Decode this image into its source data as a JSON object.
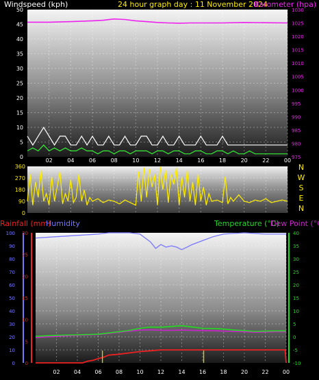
{
  "header": {
    "wind_label": "Windspeed (kph)",
    "title": "24 hour graph day : 11 November 2024",
    "baro_label": "Barometer (hpa)"
  },
  "bottom_header": {
    "rain_label": "Rainfall (mm)",
    "humidity_label": "Humidity",
    "temp_label": "Temperature (°C)",
    "dew_label": "Dew Point (°C)"
  },
  "colors": {
    "wind": "#ffffff",
    "gust": "#cccccc",
    "wind_avg": "#33ee33",
    "baro": "#ee22ee",
    "direction": "#ffee00",
    "rain": "#ee2222",
    "rain_tick": "#cccc22",
    "humidity": "#7777ff",
    "temp": "#22dd22",
    "dew": "#cc22cc"
  },
  "chart_data": [
    {
      "type": "line",
      "title": "24 hour graph day : 11 November 2024",
      "x_ticks": [
        "02",
        "04",
        "06",
        "08",
        "10",
        "12",
        "14",
        "16",
        "18",
        "20",
        "22",
        "00"
      ],
      "left_axis": {
        "label": "Windspeed (kph)",
        "ylim": [
          0,
          50
        ],
        "ticks": [
          "0",
          "5",
          "10",
          "15",
          "20",
          "25",
          "30",
          "35",
          "40",
          "45",
          "50"
        ]
      },
      "right_axis": {
        "label": "Barometer (hpa)",
        "ylim": [
          975,
          1030
        ],
        "ticks": [
          "975",
          "980",
          "985",
          "990",
          "995",
          "1000",
          "1005",
          "1010",
          "1015",
          "1020",
          "1025",
          "1030"
        ]
      },
      "series": [
        {
          "name": "Barometer (hpa)",
          "axis": "right",
          "x": [
            0,
            2,
            4,
            6,
            7,
            8,
            9,
            10,
            11,
            12,
            13,
            14,
            15,
            16,
            18,
            20,
            22,
            24
          ],
          "values": [
            1025.3,
            1025.3,
            1025.5,
            1025.8,
            1026.0,
            1026.5,
            1026.3,
            1025.8,
            1025.5,
            1025.2,
            1025.0,
            1024.9,
            1025.0,
            1025.0,
            1025.0,
            1025.2,
            1025.1,
            1025.0
          ]
        },
        {
          "axis": "left",
          "x": [
            0,
            0.5,
            1,
            1.5,
            2,
            2.5,
            3,
            3.5,
            4,
            4.5,
            5,
            5.5,
            6,
            6.5,
            7,
            7.5,
            8,
            8.5,
            9,
            9.5,
            10,
            10.5,
            11,
            11.5,
            12,
            12.5,
            13,
            13.5,
            14,
            14.5,
            15,
            15.5,
            16,
            16.5,
            17,
            17.5,
            18,
            18.5,
            19,
            19.5,
            20,
            20.5,
            21,
            21.5,
            22,
            22.5,
            23,
            23.5,
            24
          ],
          "values": [
            7,
            4,
            7,
            10,
            7,
            4,
            7,
            7,
            4,
            4,
            7,
            4,
            7,
            4,
            4,
            7,
            4,
            4,
            7,
            4,
            4,
            7,
            7,
            4,
            4,
            7,
            4,
            4,
            7,
            4,
            4,
            4,
            7,
            4,
            4,
            4,
            7,
            4,
            4,
            4,
            4,
            4,
            4,
            4,
            4,
            4,
            4,
            4,
            4
          ]
        },
        {
          "axis": "left",
          "x": [
            0,
            0.5,
            1,
            1.5,
            2,
            2.5,
            3,
            3.5,
            4,
            4.5,
            5,
            5.5,
            6,
            6.5,
            7,
            7.5,
            8,
            8.5,
            9,
            9.5,
            10,
            10.5,
            11,
            11.5,
            12,
            12.5,
            13,
            13.5,
            14,
            14.5,
            15,
            15.5,
            16,
            16.5,
            17,
            17.5,
            18,
            18.5,
            19,
            19.5,
            20,
            20.5,
            21,
            21.5,
            22,
            22.5,
            23,
            23.5,
            24
          ],
          "values": [
            2,
            3,
            2,
            4,
            2,
            3,
            2,
            3,
            2,
            2,
            3,
            2,
            2,
            1,
            2,
            2,
            1,
            2,
            2,
            1,
            2,
            2,
            2,
            1,
            2,
            2,
            1,
            2,
            2,
            1,
            1,
            2,
            2,
            1,
            1,
            2,
            2,
            1,
            2,
            1,
            1,
            2,
            1,
            1,
            1,
            1,
            1,
            1,
            1
          ]
        }
      ]
    },
    {
      "type": "line",
      "x_ticks": [
        "02",
        "04",
        "06",
        "08",
        "10",
        "12",
        "14",
        "16",
        "18",
        "20",
        "22",
        "00"
      ],
      "left_axis": {
        "ylim": [
          0,
          360
        ],
        "ticks": [
          "0",
          "90",
          "180",
          "270",
          "360"
        ]
      },
      "right_labels": [
        "N",
        "W",
        "S",
        "E",
        "N"
      ],
      "series": [
        {
          "axis": "left",
          "x": [
            0,
            0.25,
            0.5,
            0.75,
            1,
            1.25,
            1.5,
            1.75,
            2,
            2.25,
            2.5,
            2.75,
            3,
            3.25,
            3.5,
            3.75,
            4,
            4.25,
            4.5,
            4.75,
            5,
            5.25,
            5.5,
            5.75,
            6,
            6.5,
            7,
            7.5,
            8,
            8.5,
            9,
            9.5,
            10,
            10.25,
            10.5,
            10.75,
            11,
            11.25,
            11.5,
            11.75,
            12,
            12.25,
            12.5,
            12.75,
            13,
            13.25,
            13.5,
            13.75,
            14,
            14.25,
            14.5,
            14.75,
            15,
            15.25,
            15.5,
            15.75,
            16,
            16.25,
            16.5,
            16.75,
            17,
            17.5,
            18,
            18.25,
            18.5,
            18.75,
            19,
            19.5,
            20,
            20.5,
            21,
            21.5,
            22,
            22.5,
            23,
            23.5,
            24
          ],
          "values": [
            90,
            300,
            60,
            240,
            120,
            330,
            90,
            150,
            60,
            280,
            90,
            200,
            320,
            70,
            150,
            90,
            260,
            80,
            120,
            300,
            90,
            180,
            60,
            120,
            90,
            110,
            80,
            100,
            90,
            70,
            100,
            80,
            60,
            320,
            90,
            350,
            120,
            340,
            200,
            300,
            60,
            360,
            180,
            330,
            80,
            300,
            220,
            350,
            60,
            280,
            120,
            330,
            90,
            240,
            60,
            300,
            90,
            200,
            60,
            150,
            90,
            100,
            80,
            280,
            70,
            120,
            90,
            140,
            90,
            80,
            100,
            90,
            110,
            80,
            90,
            100,
            90
          ]
        }
      ]
    },
    {
      "type": "line",
      "x_ticks": [
        "02",
        "04",
        "06",
        "08",
        "10",
        "12",
        "14",
        "16",
        "18",
        "20",
        "22",
        "00"
      ],
      "humidity_axis": {
        "label": "Humidity",
        "ylim": [
          0,
          100
        ],
        "ticks": [
          "0",
          "10",
          "20",
          "30",
          "40",
          "50",
          "60",
          "70",
          "80",
          "90",
          "100"
        ]
      },
      "rain_axis": {
        "label": "Rainfall (mm)",
        "ylim": [
          0,
          30
        ],
        "ticks": [
          "0",
          "5",
          "10",
          "15",
          "20",
          "25",
          "30"
        ]
      },
      "temp_axis": {
        "label": "Temperature (°C)",
        "ylim": [
          -10,
          40
        ],
        "ticks": [
          "-10",
          "-5",
          "0",
          "5",
          "10",
          "15",
          "20",
          "25",
          "30",
          "35",
          "40"
        ]
      },
      "series": [
        {
          "name": "Humidity",
          "axis": "humidity",
          "x": [
            0,
            2,
            4,
            6,
            7,
            8,
            9,
            10,
            10.5,
            11,
            11.5,
            12,
            12.5,
            13,
            13.5,
            14,
            14.5,
            15,
            16,
            17,
            18,
            20,
            22,
            24
          ],
          "values": [
            96,
            97,
            98,
            99,
            100,
            100,
            100,
            99,
            96,
            93,
            88,
            91,
            89,
            90,
            89,
            87,
            89,
            91,
            94,
            97,
            99,
            100,
            99,
            99
          ]
        },
        {
          "name": "Temperature (°C)",
          "axis": "temp",
          "x": [
            0,
            2,
            4,
            6,
            7,
            8,
            9,
            10,
            11,
            12,
            13,
            14,
            15,
            16,
            17,
            18,
            19,
            20,
            21,
            22,
            23,
            24
          ],
          "values": [
            0.2,
            0.6,
            0.8,
            1.0,
            1.5,
            2.0,
            2.5,
            3.3,
            3.8,
            3.7,
            4.0,
            4.3,
            3.8,
            3.3,
            3.2,
            3.0,
            2.6,
            2.4,
            2.1,
            2.2,
            2.3,
            2.3
          ]
        },
        {
          "name": "Dew Point (°C)",
          "axis": "temp",
          "x": [
            0,
            2,
            4,
            6,
            7,
            8,
            9,
            10,
            11,
            12,
            13,
            14,
            15,
            16,
            17,
            18,
            19,
            20,
            21,
            22,
            23,
            24
          ],
          "values": [
            -0.2,
            0.2,
            0.6,
            0.9,
            1.3,
            1.8,
            2.2,
            2.6,
            2.7,
            2.5,
            2.5,
            2.6,
            2.5,
            2.4,
            2.4,
            2.2,
            2.1,
            2.0,
            1.8,
            1.9,
            2.0,
            2.0
          ]
        },
        {
          "name": "Rainfall (mm)",
          "axis": "rain",
          "x": [
            0,
            3,
            4.5,
            5,
            5.5,
            6,
            6.5,
            7,
            8,
            9,
            10,
            11,
            12,
            13,
            14,
            16,
            18,
            20,
            22,
            23.9,
            24
          ],
          "values": [
            0,
            0,
            0,
            0.4,
            0.6,
            1.0,
            1.3,
            1.8,
            2.0,
            2.3,
            2.6,
            2.8,
            3.0,
            3.0,
            3.0,
            3.0,
            3.0,
            3.0,
            3.0,
            3.0,
            0
          ]
        }
      ]
    }
  ]
}
